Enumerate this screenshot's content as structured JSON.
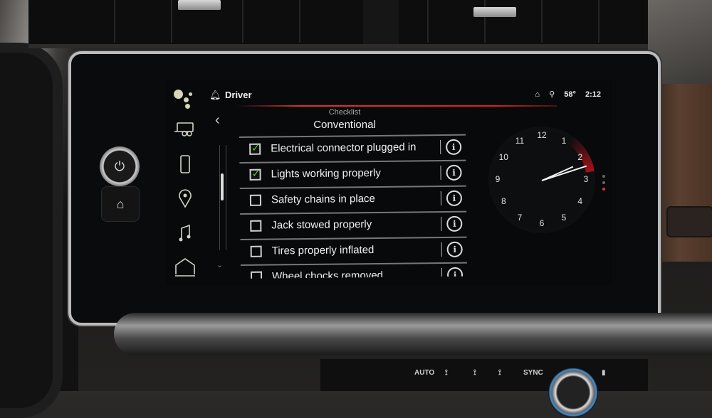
{
  "header": {
    "profile_name": "Driver",
    "temperature": "58°",
    "time": "2:12",
    "status_icons": [
      "lock-icon",
      "location-pin-icon"
    ]
  },
  "sidebar": {
    "items": [
      {
        "icon": "assistant-icon",
        "label": "Assistant"
      },
      {
        "icon": "trailer-icon",
        "label": "Trailering"
      },
      {
        "icon": "phone-icon",
        "label": "Phone"
      },
      {
        "icon": "location-pin-icon",
        "label": "Navigation"
      },
      {
        "icon": "music-note-icon",
        "label": "Audio"
      },
      {
        "icon": "home-icon",
        "label": "Home"
      }
    ]
  },
  "page": {
    "subtitle": "Checklist",
    "title": "Conventional",
    "back_label": "‹",
    "scroll_down_label": "⌄"
  },
  "checklist": [
    {
      "label": "Electrical connector plugged in",
      "checked": true
    },
    {
      "label": "Lights working properly",
      "checked": true
    },
    {
      "label": "Safety chains in place",
      "checked": false
    },
    {
      "label": "Jack stowed properly",
      "checked": false
    },
    {
      "label": "Tires properly inflated",
      "checked": false
    },
    {
      "label": "Wheel chocks removed",
      "checked": false
    }
  ],
  "clock": {
    "numerals": [
      "12",
      "1",
      "2",
      "3",
      "4",
      "5",
      "6",
      "7",
      "8",
      "9",
      "10",
      "11"
    ],
    "hour": 2,
    "minute": 12
  },
  "page_indicator": {
    "count": 3,
    "active": 3
  },
  "hardware": {
    "power_glyph": "⏻",
    "home_glyph": "⌂"
  },
  "climate": {
    "buttons": [
      "AUTO",
      "SYNC"
    ]
  },
  "colors": {
    "accent": "#e03131",
    "check": "#5ecc3a",
    "text": "#f0f0f0"
  }
}
